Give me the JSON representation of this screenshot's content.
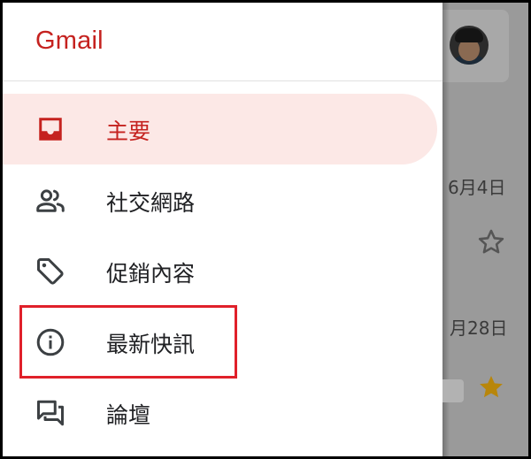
{
  "app": {
    "logo": "Gmail"
  },
  "drawer": {
    "items": [
      {
        "label": "主要",
        "icon": "inbox-icon",
        "active": true
      },
      {
        "label": "社交網路",
        "icon": "people-icon",
        "active": false
      },
      {
        "label": "促銷內容",
        "icon": "tag-icon",
        "active": false
      },
      {
        "label": "最新快訊",
        "icon": "info-icon",
        "active": false,
        "highlighted": true
      },
      {
        "label": "論壇",
        "icon": "forum-icon",
        "active": false
      }
    ]
  },
  "background": {
    "dates": [
      "6月4日",
      "月28日"
    ],
    "stars": [
      {
        "icon": "star-outline-icon",
        "starred": false
      },
      {
        "icon": "star-filled-icon",
        "starred": true
      }
    ]
  },
  "colors": {
    "brand": "#c5221f",
    "active_bg": "#fce8e6",
    "highlight_border": "#e0202a",
    "star": "#f4b400",
    "scrim": "#9a9a9a"
  }
}
